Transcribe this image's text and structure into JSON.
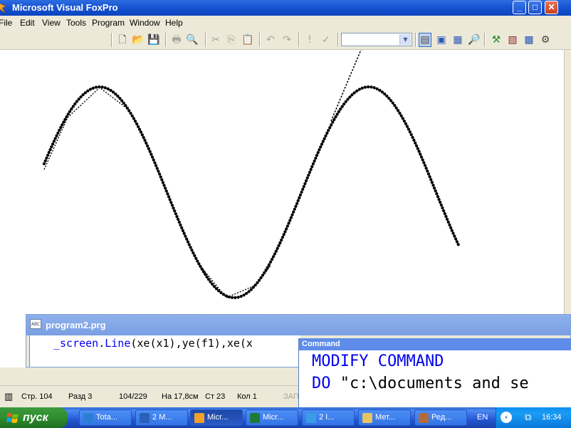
{
  "window": {
    "title": "Microsoft Visual FoxPro",
    "controls": {
      "minimize": "_",
      "maximize": "□",
      "close": "✕"
    }
  },
  "menu": [
    "File",
    "Edit",
    "View",
    "Tools",
    "Program",
    "Window",
    "Help"
  ],
  "toolbar": {
    "icons": [
      "new-icon",
      "open-icon",
      "save-icon",
      "print-icon",
      "print-preview-icon",
      "cut-icon",
      "copy-icon",
      "paste-icon",
      "undo-icon",
      "redo-icon",
      "run-icon",
      "modify-form-icon",
      "database-combo",
      "command-window-icon",
      "properties-icon",
      "data-session-icon",
      "class-browser-icon",
      "form-wizard-icon",
      "report-icon",
      "options-icon",
      "help-icon"
    ],
    "combo_value": ""
  },
  "editor": {
    "title": "program2.prg",
    "icon_text": "ABC",
    "code_kw1": "_screen",
    "code_dot": ".",
    "code_kw2": "Line",
    "code_rest": "(xe(x1),ye(f1),xe(x"
  },
  "command": {
    "title": "Command",
    "line1_kw": "MODIFY COMMAND",
    "line2_kw": "DO",
    "line2_rest": " \"c:\\documents and se"
  },
  "status": {
    "row": "Стр. 104",
    "sect": "Разд 3",
    "pos": "104/229",
    "at": "На 17,8см",
    "line": "Ст 23",
    "col": "Кол 1",
    "mode": "ЗАП"
  },
  "taskbar": {
    "start": "пуск",
    "tasks": [
      {
        "label": "Tota...",
        "color": "#2a7fd4"
      },
      {
        "label": "2 M...",
        "color": "#2b5fb8"
      },
      {
        "label": "Micr...",
        "color": "#f2a12b"
      },
      {
        "label": "Micr...",
        "color": "#1f7a3a"
      },
      {
        "label": "2 I...",
        "color": "#3a9be6"
      },
      {
        "label": "Мет...",
        "color": "#e8c462"
      },
      {
        "label": "Ред...",
        "color": "#b36a3b"
      }
    ],
    "lang": "EN",
    "clock": "16:34"
  }
}
